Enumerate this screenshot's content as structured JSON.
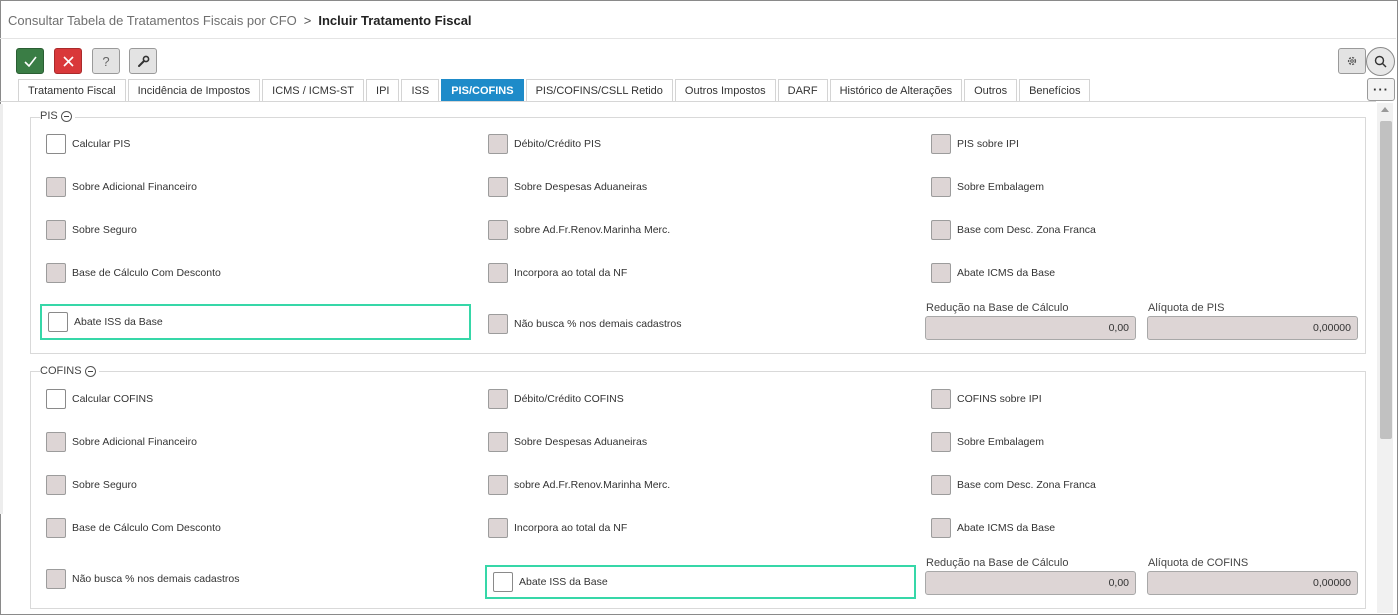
{
  "breadcrumb": {
    "parent": "Consultar Tabela de Tratamentos Fiscais por CFO",
    "separator": ">",
    "current": "Incluir Tratamento Fiscal"
  },
  "toolbar": {
    "confirm_icon": "check-icon",
    "cancel_icon": "close-icon",
    "help_label": "?",
    "tool_icon": "wrench-icon",
    "settings_icon": "gear-icon",
    "search_icon": "search-icon",
    "more_label": "···"
  },
  "tabs": [
    {
      "label": "Tratamento Fiscal"
    },
    {
      "label": "Incidência de Impostos"
    },
    {
      "label": "ICMS / ICMS-ST"
    },
    {
      "label": "IPI"
    },
    {
      "label": "ISS"
    },
    {
      "label": "PIS/COFINS",
      "active": true
    },
    {
      "label": "PIS/COFINS/CSLL Retido"
    },
    {
      "label": "Outros Impostos"
    },
    {
      "label": "DARF"
    },
    {
      "label": "Histórico de Alterações"
    },
    {
      "label": "Outros"
    },
    {
      "label": "Benefícios"
    }
  ],
  "pis": {
    "title": "PIS",
    "items": [
      {
        "label": "Calcular PIS"
      },
      {
        "label": "Débito/Crédito PIS"
      },
      {
        "label": "PIS sobre IPI"
      },
      {
        "label": "Sobre Adicional Financeiro"
      },
      {
        "label": "Sobre Despesas Aduaneiras"
      },
      {
        "label": "Sobre Embalagem"
      },
      {
        "label": "Sobre Seguro"
      },
      {
        "label": "sobre Ad.Fr.Renov.Marinha Merc."
      },
      {
        "label": "Base com Desc. Zona Franca"
      },
      {
        "label": "Base de Cálculo Com Desconto"
      },
      {
        "label": "Incorpora ao total da NF"
      },
      {
        "label": "Abate ICMS da Base"
      },
      {
        "label": "Abate ISS da Base"
      },
      {
        "label": "Não busca % nos demais cadastros"
      }
    ],
    "reducao_label": "Redução na Base de Cálculo",
    "reducao_value": "0,00",
    "aliquota_label": "Alíquota de PIS",
    "aliquota_value": "0,00000"
  },
  "cofins": {
    "title": "COFINS",
    "items": [
      {
        "label": "Calcular COFINS"
      },
      {
        "label": "Débito/Crédito COFINS"
      },
      {
        "label": "COFINS sobre IPI"
      },
      {
        "label": "Sobre Adicional Financeiro"
      },
      {
        "label": "Sobre Despesas Aduaneiras"
      },
      {
        "label": "Sobre Embalagem"
      },
      {
        "label": "Sobre Seguro"
      },
      {
        "label": "sobre Ad.Fr.Renov.Marinha Merc."
      },
      {
        "label": "Base com Desc. Zona Franca"
      },
      {
        "label": "Base de Cálculo Com Desconto"
      },
      {
        "label": "Incorpora ao total da NF"
      },
      {
        "label": "Abate ICMS da Base"
      },
      {
        "label": "Não busca % nos demais cadastros"
      },
      {
        "label": "Abate ISS da Base"
      }
    ],
    "reducao_label": "Redução na Base de Cálculo",
    "reducao_value": "0,00",
    "aliquota_label": "Alíquota de COFINS",
    "aliquota_value": "0,00000"
  },
  "colors": {
    "accent": "#1e8bc9",
    "confirm": "#3a7d45",
    "cancel": "#d9383a",
    "highlight": "#36d7a8",
    "disabled_field": "#ddd5d5"
  }
}
